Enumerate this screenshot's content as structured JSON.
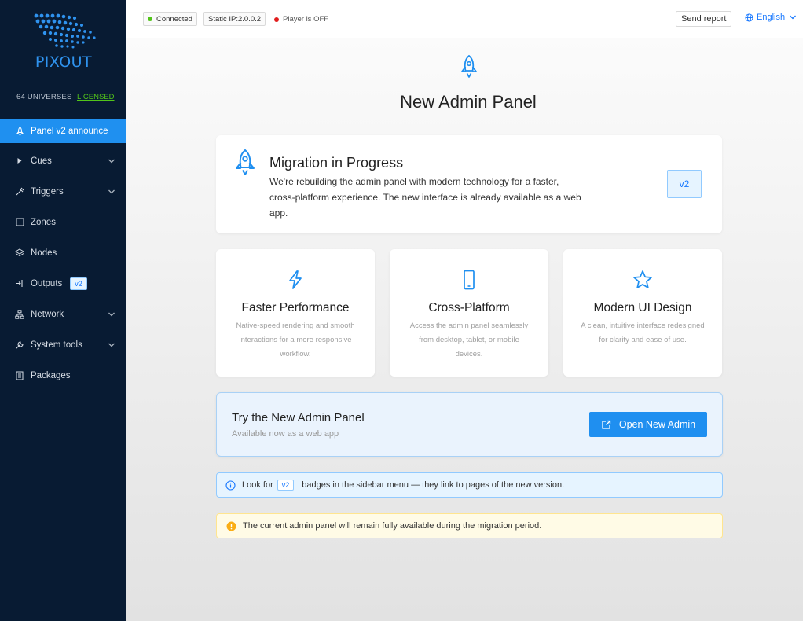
{
  "brand": {
    "logo_text": "PIXOUT",
    "universes": "64 UNIVERSES",
    "license": "LICENSED"
  },
  "colors": {
    "sidebar_bg": "#081b33",
    "accent": "#1f90f0",
    "licensed": "#52c41a",
    "status_ok": "#52c41a",
    "status_off": "#e11d1d"
  },
  "sidebar": {
    "items": [
      {
        "label": "Panel v2 announce",
        "icon": "rocket-icon",
        "active": true
      },
      {
        "label": "Cues",
        "icon": "play-icon",
        "expandable": true
      },
      {
        "label": "Triggers",
        "icon": "trigger-icon",
        "expandable": true
      },
      {
        "label": "Zones",
        "icon": "grid-icon"
      },
      {
        "label": "Nodes",
        "icon": "nodes-icon"
      },
      {
        "label": "Outputs",
        "icon": "output-icon",
        "badge": "v2"
      },
      {
        "label": "Network",
        "icon": "network-icon",
        "expandable": true
      },
      {
        "label": "System tools",
        "icon": "wrench-icon",
        "expandable": true
      },
      {
        "label": "Packages",
        "icon": "package-icon"
      }
    ]
  },
  "header": {
    "status": "Connected",
    "ip": "Static IP:2.0.0.2",
    "player": "Player is OFF",
    "send_report": "Send report",
    "language": "English"
  },
  "main": {
    "title": "New Admin Panel",
    "migration": {
      "title": "Migration in Progress",
      "text": "We're rebuilding the admin panel with modern technology for a faster, cross-platform experience. The new interface is already available as a web app.",
      "badge": "v2"
    },
    "features": [
      {
        "icon": "lightning-icon",
        "title": "Faster Performance",
        "desc": "Native-speed rendering and smooth interactions for a more responsive workflow."
      },
      {
        "icon": "mobile-icon",
        "title": "Cross-Platform",
        "desc": "Access the admin panel seamlessly from desktop, tablet, or mobile devices."
      },
      {
        "icon": "star-icon",
        "title": "Modern UI Design",
        "desc": "A clean, intuitive interface redesigned for clarity and ease of use."
      }
    ],
    "try": {
      "title": "Try the New Admin Panel",
      "subtitle": "Available now as a web app",
      "button": "Open New Admin"
    },
    "info": {
      "before": "Look for",
      "badge": "v2",
      "after": "badges in the sidebar menu — they link to pages of the new version."
    },
    "warning": "The current admin panel will remain fully available during the migration period."
  }
}
